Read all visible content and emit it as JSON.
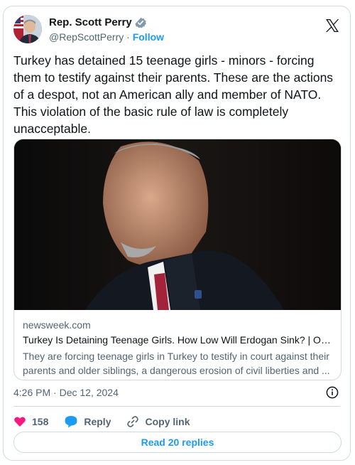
{
  "author": {
    "display_name": "Rep. Scott Perry",
    "handle": "@RepScottPerry",
    "separator": "·",
    "follow_label": "Follow"
  },
  "tweet": {
    "text": "Turkey has detained 15 teenage girls - minors - forcing them to testify against their parents. These are the actions of a despot, not an American ally and member of NATO. This violation of the basic rule of law is completely unacceptable."
  },
  "link_card": {
    "domain": "newsweek.com",
    "title": "Turkey Is Detaining Teenage Girls. How Low Will Erdogan Sink? | Opin...",
    "description": "They are forcing teenage girls in Turkey to testify in court against their parents and older siblings, a dangerous erosion of civil liberties and ..."
  },
  "timestamp": "4:26 PM · Dec 12, 2024",
  "actions": {
    "likes": "158",
    "reply_label": "Reply",
    "copy_link_label": "Copy link"
  },
  "read_replies_label": "Read 20 replies",
  "colors": {
    "accent": "#1d9bf0",
    "heart": "#f91880",
    "muted": "#536471",
    "border": "#cfd9de"
  },
  "icons": [
    "avatar",
    "verified-badge-icon",
    "x-logo-icon",
    "info-icon",
    "heart-icon",
    "reply-bubble-icon",
    "link-icon"
  ]
}
